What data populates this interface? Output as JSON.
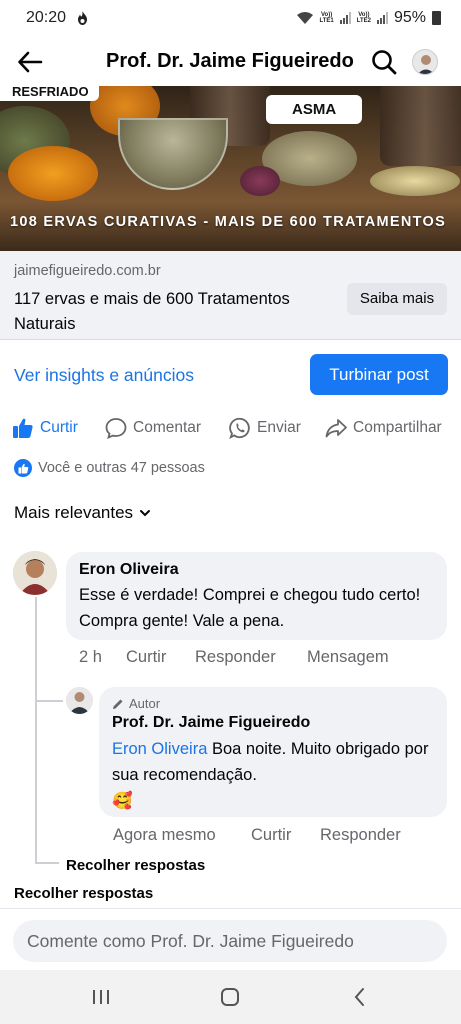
{
  "status_bar": {
    "time": "20:20",
    "battery": "95%",
    "sim1": "LTE1",
    "sim2": "LTE2",
    "volte": "Vo))"
  },
  "header": {
    "title": "Prof. Dr. Jaime Figueiredo",
    "icons": [
      "arrow-left-icon",
      "search-icon"
    ]
  },
  "banner": {
    "tag_top": "RESFRIADO",
    "tag_asma": "ASMA",
    "caption": "108 ERVAS CURATIVAS - MAIS DE 600 TRATAMENTOS"
  },
  "link_preview": {
    "domain": "jaimefigueiredo.com.br",
    "title": "117 ervas e mais de 600 Tratamentos Naturais",
    "cta": "Saiba mais"
  },
  "insights": {
    "link": "Ver insights e anúncios",
    "boost": "Turbinar post"
  },
  "actions": {
    "like": "Curtir",
    "comment": "Comentar",
    "send": "Enviar",
    "share": "Compartilhar"
  },
  "reactions": {
    "summary": "Você e outras 47 pessoas"
  },
  "sort": {
    "label": "Mais relevantes"
  },
  "comments": [
    {
      "author": "Eron Oliveira",
      "text": "Esse é  verdade! Comprei e chegou tudo certo!  Compra gente! Vale a pena.",
      "time": "2 h",
      "like": "Curtir",
      "reply": "Responder",
      "message": "Mensagem"
    }
  ],
  "reply": {
    "badge": "Autor",
    "author": "Prof. Dr. Jaime Figueiredo",
    "mention": "Eron Oliveira",
    "text": " Boa noite. Muito obrigado por sua recomendação.",
    "emoji": "🥰",
    "time": "Agora mesmo",
    "like": "Curtir",
    "reply": "Responder"
  },
  "collapse_replies_inner": "Recolher respostas",
  "collapse_replies_outer": "Recolher respostas",
  "comment_box": {
    "placeholder": "Comente como Prof. Dr. Jaime Figueiredo"
  },
  "colors": {
    "accent": "#1877f2",
    "link": "#1b74e4",
    "muted": "#65676b",
    "bubble": "#f0f2f5"
  }
}
